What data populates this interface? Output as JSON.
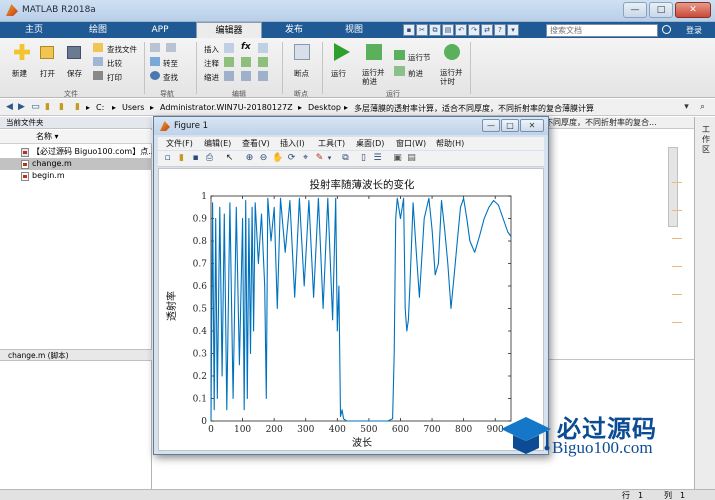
{
  "window": {
    "title": "MATLAB R2018a",
    "minimize": "—",
    "maximize": "□",
    "close": "✕"
  },
  "tabs": [
    "主页",
    "绘图",
    "APP",
    "编辑器",
    "发布",
    "视图"
  ],
  "search": {
    "placeholder": "搜索文档"
  },
  "login": "登录",
  "ribbon": {
    "file_group": {
      "new": "新建",
      "open": "打开",
      "save": "保存",
      "find_files": "查找文件",
      "compare": "比较",
      "print": "打印",
      "label": "文件"
    },
    "nav_group": {
      "goto": "转至",
      "find": "查找",
      "label": "导航"
    },
    "edit_group": {
      "insert": "插入",
      "comment": "注释",
      "indent": "缩进",
      "fx": "fx",
      "label": "编辑"
    },
    "breakpoints_group": {
      "breakpoints": "断点",
      "label": "断点"
    },
    "run_group": {
      "run": "运行",
      "run_advance": "运行并前进",
      "run_section": "运行节",
      "advance": "前进",
      "run_time": "运行并计时",
      "label": "运行"
    }
  },
  "path": {
    "segments": [
      "C:",
      "Users",
      "Administrator.WIN7U-20180127Z",
      "Desktop",
      "多层薄膜的透射率计算，适合不同厚度，不同折射率的复合薄膜计算"
    ]
  },
  "left_panel": {
    "title": "当前文件夹",
    "column": "名称",
    "files": [
      {
        "name": "【必过源码 Biguo100.com】点..."
      },
      {
        "name": "change.m"
      },
      {
        "name": "begin.m"
      }
    ],
    "details": "change.m  (脚本)"
  },
  "editor": {
    "tab_text": "不同厚度，不同折射率的复合..."
  },
  "workspace_label": "工作区",
  "status": {
    "row_label": "行",
    "row": "1",
    "col_label": "列",
    "col": "1"
  },
  "figure": {
    "title": "Figure 1",
    "menu": [
      "文件(F)",
      "编辑(E)",
      "查看(V)",
      "插入(I)",
      "工具(T)",
      "桌面(D)",
      "窗口(W)",
      "帮助(H)"
    ]
  },
  "chart_data": {
    "type": "line",
    "title": "投射率随薄波长的变化",
    "xlabel": "波长",
    "ylabel": "透射率",
    "xlim": [
      0,
      950
    ],
    "ylim": [
      0,
      1
    ],
    "xticks": [
      0,
      100,
      200,
      300,
      400,
      500,
      600,
      700,
      800,
      900
    ],
    "yticks": [
      0,
      0.1,
      0.2,
      0.3,
      0.4,
      0.5,
      0.6,
      0.7,
      0.8,
      0.9,
      1
    ],
    "grid": false,
    "series": [
      {
        "color": "#0072BD",
        "x": [
          0,
          5,
          10,
          15,
          20,
          28,
          35,
          42,
          50,
          60,
          70,
          80,
          90,
          100,
          105,
          110,
          115,
          120,
          125,
          130,
          135,
          140,
          150,
          160,
          170,
          175,
          180,
          190,
          200,
          210,
          220,
          235,
          250,
          265,
          280,
          295,
          310,
          325,
          340,
          355,
          370,
          385,
          395,
          400,
          405,
          410,
          415,
          420,
          430,
          440,
          450,
          470,
          500,
          530,
          560,
          575,
          580,
          585,
          590,
          600,
          610,
          615,
          620,
          625,
          630,
          640,
          650,
          660,
          675,
          690,
          700,
          710,
          720,
          730,
          740,
          750,
          760,
          770,
          780,
          790,
          800,
          810,
          820,
          835,
          850,
          865,
          880,
          895,
          910,
          925,
          940,
          950
        ],
        "y": [
          0,
          0.97,
          0.05,
          0.9,
          0.1,
          0.95,
          0.2,
          0.92,
          0.05,
          0.97,
          0.1,
          0.95,
          0.25,
          0.9,
          0.05,
          0.98,
          0.1,
          0.9,
          0.3,
          0.95,
          0.4,
          0.97,
          0.7,
          0.92,
          0.6,
          0.1,
          0.99,
          0.8,
          0.95,
          0.5,
          0.99,
          0.75,
          0.98,
          0.55,
          0.99,
          0.6,
          0.98,
          0.55,
          0.99,
          0.5,
          0.99,
          0.45,
          0.99,
          0.4,
          0.6,
          0.02,
          0.05,
          0.01,
          0,
          0,
          0,
          0,
          0,
          0,
          0,
          0.01,
          0.3,
          0.9,
          0.99,
          0.9,
          0.99,
          0.5,
          0.4,
          0.45,
          0.6,
          0.97,
          0.75,
          0.55,
          0.9,
          0.99,
          0.85,
          0.65,
          0.7,
          0.98,
          0.85,
          0.7,
          0.5,
          0.65,
          0.8,
          0.95,
          0.99,
          0.9,
          0.8,
          0.75,
          0.82,
          0.9,
          0.95,
          0.98,
          0.96,
          0.9,
          0.84,
          0.82
        ]
      }
    ]
  },
  "watermark": {
    "main": "必过源码",
    "sub": "Biguo100.com"
  }
}
